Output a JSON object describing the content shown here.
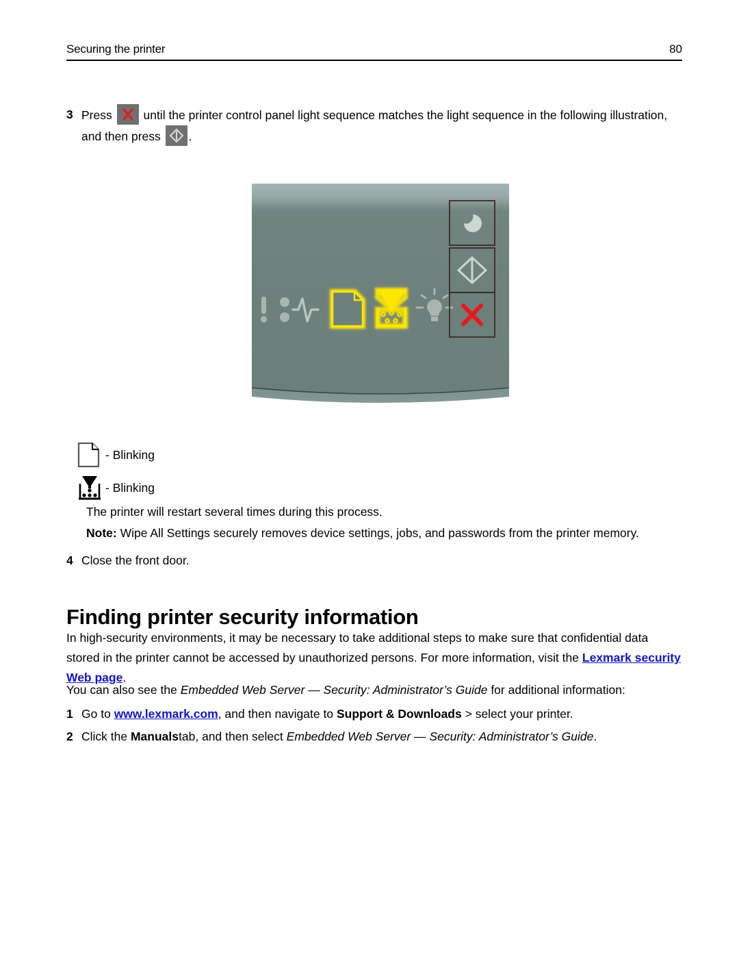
{
  "header": {
    "title": "Securing the printer",
    "page_number": "80"
  },
  "steps": [
    {
      "number": "3",
      "text_before_key1": "Press",
      "key1": "cancel-x-button",
      "text_after_key1": "until the printer control panel light sequence matches the light sequence in the following illustration, and then press",
      "key2": "start-diamond-button",
      "text_end": "."
    },
    {
      "number": "4",
      "text": "Close the front door."
    }
  ],
  "illustration": {
    "name": "printer-control-panel",
    "panel_color": "#6f8280",
    "panel_highlight_color": "#a9bab6",
    "indicator_lit_color": "#ffe800",
    "indicator_off_color": "#aab5b2",
    "cancel_color": "#e8191e",
    "indicators": [
      {
        "name": "error-icon",
        "label": "!",
        "state": "off"
      },
      {
        "name": "paper-jam-icon",
        "label": "Paper jam",
        "state": "off"
      },
      {
        "name": "load-paper-icon",
        "label": "Load paper",
        "state": "blinking"
      },
      {
        "name": "toner-icon",
        "label": "Toner",
        "state": "blinking"
      },
      {
        "name": "ready-icon",
        "label": "Ready",
        "state": "off"
      }
    ],
    "buttons": [
      {
        "name": "sleep-button",
        "label": "Sleep"
      },
      {
        "name": "start-button",
        "label": "Start"
      },
      {
        "name": "cancel-button",
        "label": "Cancel"
      }
    ]
  },
  "legend": [
    {
      "icon": "load-paper-icon",
      "text": "- Blinking"
    },
    {
      "icon": "toner-icon",
      "text": "- Blinking"
    }
  ],
  "notes": {
    "restart": "The printer will restart several times during this process.",
    "note_label": "Note:",
    "note_text": "Wipe All Settings securely removes device settings, jobs, and passwords from the printer memory."
  },
  "section": {
    "heading": "Finding printer security information",
    "intro_part1": "In high-security environments, it may be necessary to take additional steps to make sure that confidential data stored in the printer cannot be accessed by unauthorized persons. For more information, visit the",
    "link_label": "Lexmark security Web page",
    "intro_end": ".",
    "also_see_prefix": "You can also see the",
    "guide_title": "Embedded Web Server — Security: Administrator’s Guide",
    "also_see_suffix": "for additional information:",
    "list": [
      {
        "number": "1",
        "pre": "Go to",
        "url": "www.lexmark.com",
        "mid": ", and then navigate to",
        "bold_path": "Support & Downloads",
        "post": "> select your printer."
      },
      {
        "number": "2",
        "pre": "Click the",
        "bold_tab": "Manuals",
        "mid": "tab, and then select",
        "italic_guide": "Embedded Web Server — Security: Administrator’s Guide",
        "post": "."
      }
    ]
  }
}
